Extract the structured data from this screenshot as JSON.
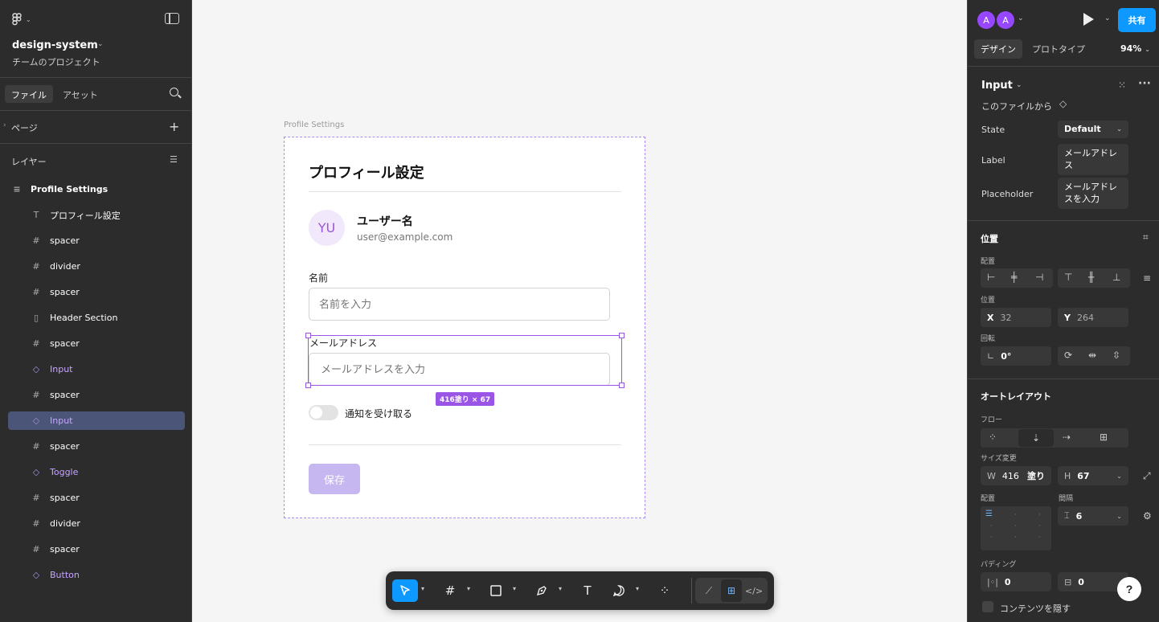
{
  "left": {
    "project_name": "design-system",
    "project_team": "チームのプロジェクト",
    "tabs": [
      "ファイル",
      "アセット"
    ],
    "pages_label": "ページ",
    "layers_label": "レイヤー",
    "layers": [
      {
        "name": "Profile Settings",
        "icon": "frame-layout-icon",
        "glyph": "≡",
        "kind": "root"
      },
      {
        "name": "プロフィール設定",
        "icon": "text-icon",
        "glyph": "T",
        "kind": "normal"
      },
      {
        "name": "spacer",
        "icon": "frame-icon",
        "glyph": "#",
        "kind": "normal"
      },
      {
        "name": "divider",
        "icon": "frame-icon",
        "glyph": "#",
        "kind": "normal"
      },
      {
        "name": "spacer",
        "icon": "frame-icon",
        "glyph": "#",
        "kind": "normal"
      },
      {
        "name": "Header Section",
        "icon": "auto-layout-icon",
        "glyph": "▯",
        "kind": "normal"
      },
      {
        "name": "spacer",
        "icon": "frame-icon",
        "glyph": "#",
        "kind": "normal"
      },
      {
        "name": "Input",
        "icon": "component-instance-icon",
        "glyph": "◇",
        "kind": "comp"
      },
      {
        "name": "spacer",
        "icon": "frame-icon",
        "glyph": "#",
        "kind": "normal"
      },
      {
        "name": "Input",
        "icon": "component-instance-icon",
        "glyph": "◇",
        "kind": "comp-sel"
      },
      {
        "name": "spacer",
        "icon": "frame-icon",
        "glyph": "#",
        "kind": "normal"
      },
      {
        "name": "Toggle",
        "icon": "component-instance-icon",
        "glyph": "◇",
        "kind": "comp"
      },
      {
        "name": "spacer",
        "icon": "frame-icon",
        "glyph": "#",
        "kind": "normal"
      },
      {
        "name": "divider",
        "icon": "frame-icon",
        "glyph": "#",
        "kind": "normal"
      },
      {
        "name": "spacer",
        "icon": "frame-icon",
        "glyph": "#",
        "kind": "normal"
      },
      {
        "name": "Button",
        "icon": "component-instance-icon",
        "glyph": "◇",
        "kind": "comp"
      }
    ]
  },
  "canvas": {
    "frame_label": "Profile Settings",
    "title": "プロフィール設定",
    "avatar_initials": "YU",
    "username": "ユーザー名",
    "email": "user@example.com",
    "name_label": "名前",
    "name_placeholder": "名前を入力",
    "email_label": "メールアドレス",
    "email_placeholder": "メールアドレスを入力",
    "size_tag": "416塗り × 67",
    "toggle_label": "通知を受け取る",
    "save_label": "保存"
  },
  "right": {
    "avatars": [
      "A",
      "A"
    ],
    "share_label": "共有",
    "tabs": [
      "デザイン",
      "プロトタイプ"
    ],
    "zoom": "94%",
    "component_name": "Input",
    "component_source": "このファイルから",
    "props": [
      {
        "label": "State",
        "value": "Default"
      },
      {
        "label": "Label",
        "value": "メールアドレス"
      },
      {
        "label": "Placeholder",
        "value": "メールアドレスを入力"
      }
    ],
    "position_title": "位置",
    "align_label": "配置",
    "position_label": "位置",
    "x": "32",
    "y": "264",
    "rotation_label": "回転",
    "rotation": "0°",
    "autolayout_title": "オートレイアウト",
    "flow_label": "フロー",
    "resize_label": "サイズ変更",
    "w": "416",
    "w_mode": "塗り",
    "h": "67",
    "align2_label": "配置",
    "gap_label": "間隔",
    "gap": "6",
    "padding_label": "パディング",
    "pad_h": "0",
    "pad_v": "0",
    "clip_label": "コンテンツを隠す",
    "accent": "#0d99ff",
    "selection_color": "#9a55e6"
  }
}
